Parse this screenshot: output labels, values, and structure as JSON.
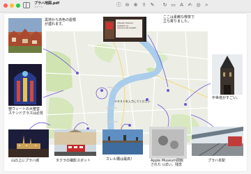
{
  "window": {
    "title": "プラハ地図.pdf",
    "subtitle": "1ページ"
  },
  "toolbar": {
    "icons": [
      "info-icon",
      "zoom-out-icon",
      "zoom-in-icon",
      "share-icon",
      "markup-icon",
      "rotate-icon",
      "crop-icon",
      "text-icon",
      "sign-icon",
      "shapes-icon",
      "search-icon"
    ]
  },
  "map": {
    "text_box": "テキストを入力してください"
  },
  "annotations": {
    "old_town": "黒地から赤色の屋根\nが連れます。",
    "cafe": "ここは素敵な喫茶で\n立ち寄りました。",
    "cathedral": "聖ヴィートの大聖堂\nステンドグラスは必見",
    "tower": "中世塔がすごい。",
    "castle": "山の上にプラハ城",
    "tram": "タクラの撮影スポット",
    "bridge": "カレル橋は最高！",
    "apple": "Apple Museum閉館\nされたっぽい。残念",
    "station": "プラハ本駅"
  },
  "cafe_sign": {
    "line1": "Vltavsk fokusní",
    "line2": "překlad na",
    "line3": "olomoucký dialekt"
  },
  "colors": {
    "river": "#a9cdea",
    "park": "#cfe4b1",
    "pen": "#6b55d6"
  }
}
